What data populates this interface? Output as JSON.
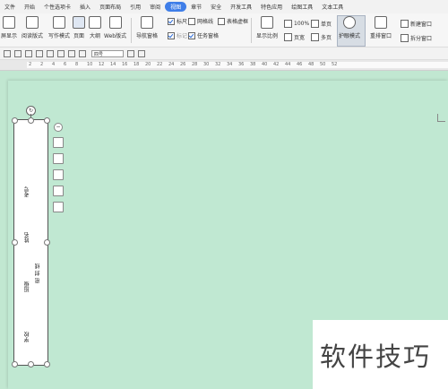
{
  "menu": [
    "文件",
    "开始",
    "个性选项卡",
    "插入",
    "页面布局",
    "引用",
    "审阅",
    "视图",
    "章节",
    "安全",
    "开发工具",
    "特色应用",
    "绘图工具",
    "文本工具"
  ],
  "ribbon": {
    "full_screen": "屏显示",
    "reading_layout": "阅读版式",
    "writing_mode": "写作模式",
    "page": "页面",
    "outline": "大纲",
    "web_layout": "Web版式",
    "nav_pane": "导航窗格",
    "ruler": "标尺",
    "gridlines": "网格线",
    "table_gridlines": "表格虚框",
    "markup": "标记",
    "task_pane": "任务窗格",
    "display_ratio": "显示比例",
    "zoom_pct": "100%",
    "page_width": "页宽",
    "single_page": "单页",
    "multi_page": "多页",
    "eye_protection": "护眼模式",
    "rearrange_window": "重排窗口",
    "new_window": "新建窗口",
    "split_window": "拆分窗口"
  },
  "format": {
    "font_size": "四号"
  },
  "ruler_marks": [
    "2",
    "2",
    "4",
    "6",
    "8",
    "10",
    "12",
    "14",
    "16",
    "18",
    "20",
    "22",
    "24",
    "26",
    "28",
    "30",
    "32",
    "34",
    "36",
    "38",
    "40",
    "42",
    "44",
    "46",
    "48",
    "50",
    "52"
  ],
  "doc": {
    "label_exam_no": "考号",
    "label_name": "姓名",
    "label_class": "班级",
    "seal_line": "密 封 线",
    "label_school": "学校"
  },
  "watermark": "软件技巧"
}
